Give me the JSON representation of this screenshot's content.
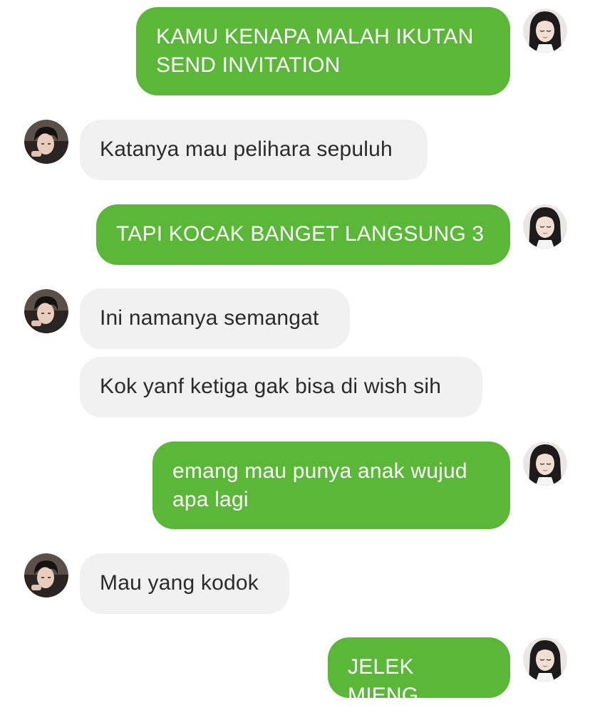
{
  "conversation": {
    "messages": [
      {
        "sender": "me",
        "text": "KAMU KENAPA MALAH IKUTAN\nSEND INVITATION"
      },
      {
        "sender": "them",
        "text": "Katanya mau pelihara sepuluh"
      },
      {
        "sender": "me",
        "text": "TAPI KOCAK BANGET LANGSUNG 3"
      },
      {
        "sender": "them",
        "text": "Ini namanya semangat"
      },
      {
        "sender": "them",
        "text": "Kok yanf ketiga gak bisa di wish sih"
      },
      {
        "sender": "me",
        "text": "emang mau punya anak wujud\napa lagi"
      },
      {
        "sender": "them",
        "text": "Mau yang kodok"
      },
      {
        "sender": "me",
        "text": "JELEK MIENG"
      }
    ]
  },
  "avatars": {
    "me": "avatar-girl-long-dark-hair",
    "them": "avatar-boy-dark-hair"
  },
  "colors": {
    "outgoing_bubble": "#5ab737",
    "incoming_bubble": "#f1f1f2",
    "outgoing_text": "#ffffff",
    "incoming_text": "#2b2b2b"
  }
}
